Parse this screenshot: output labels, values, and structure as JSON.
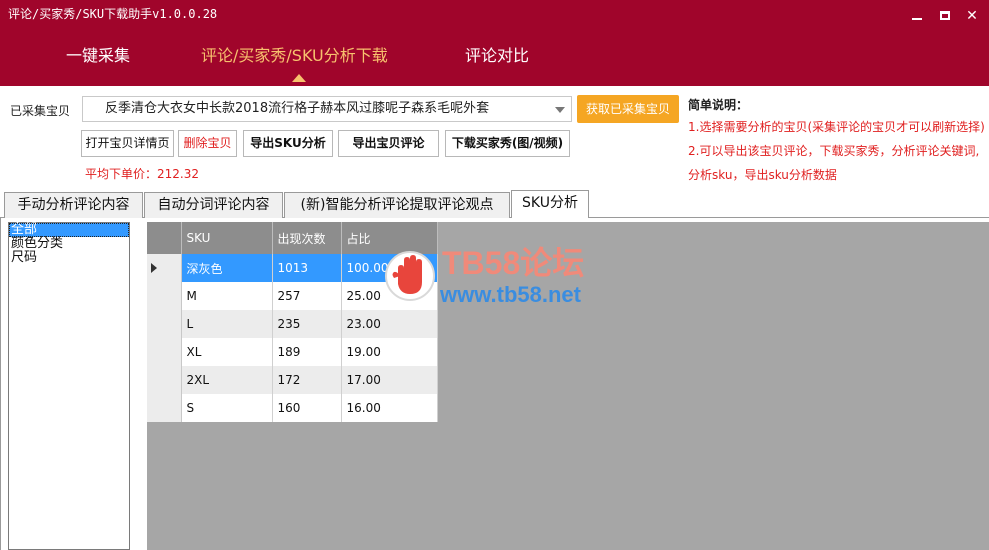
{
  "window": {
    "title": "评论/买家秀/SKU下载助手v1.0.0.28"
  },
  "nav": {
    "tabs": [
      {
        "label": "一键采集"
      },
      {
        "label": "评论/买家秀/SKU分析下载"
      },
      {
        "label": "评论对比"
      }
    ],
    "active_index": 1
  },
  "toolbar": {
    "collected_label": "已采集宝贝",
    "product_select_value": "反季清仓大衣女中长款2018流行格子赫本风过膝呢子森系毛呢外套",
    "fetch_button": "获取已采集宝贝",
    "buttons": [
      {
        "label": "打开宝贝详情页"
      },
      {
        "label": "删除宝贝"
      },
      {
        "label": "导出SKU分析"
      },
      {
        "label": "导出宝贝评论"
      },
      {
        "label": "下载买家秀(图/视频)"
      }
    ],
    "avg_price": "平均下单价：212.32"
  },
  "help": {
    "title": "简单说明：",
    "lines": [
      "1.选择需要分析的宝贝(采集评论的宝贝才可以刷新选择)",
      "2.可以导出该宝贝评论，下载买家秀，分析评论关键词,",
      "分析sku，导出sku分析数据"
    ]
  },
  "sub_tabs": [
    {
      "label": "手动分析评论内容"
    },
    {
      "label": "自动分词评论内容"
    },
    {
      "label": "(新)智能分析评论提取评论观点"
    },
    {
      "label": "SKU分析"
    }
  ],
  "sub_tab_active": 3,
  "category_list": [
    {
      "label": "全部"
    },
    {
      "label": "颜色分类"
    },
    {
      "label": "尺码"
    }
  ],
  "sku_table": {
    "headers": [
      "SKU",
      "出现次数",
      "占比"
    ],
    "rows": [
      {
        "sku": "深灰色",
        "count": "1013",
        "ratio": "100.00"
      },
      {
        "sku": "M",
        "count": "257",
        "ratio": "25.00"
      },
      {
        "sku": "L",
        "count": "235",
        "ratio": "23.00"
      },
      {
        "sku": "XL",
        "count": "189",
        "ratio": "19.00"
      },
      {
        "sku": "2XL",
        "count": "172",
        "ratio": "17.00"
      },
      {
        "sku": "S",
        "count": "160",
        "ratio": "16.00"
      }
    ]
  },
  "watermark": {
    "name": "TB58论坛",
    "url": "www.tb58.net"
  },
  "colors": {
    "brand": "#a0052b",
    "accent": "#f7c16e",
    "button_orange": "#f5a623",
    "selection": "#3399ff",
    "warning_text": "#e02020"
  }
}
